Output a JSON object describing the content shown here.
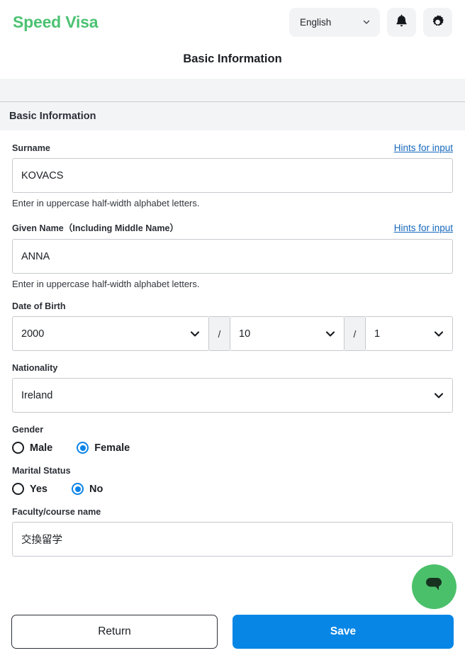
{
  "header": {
    "logo": "Speed Visa",
    "language": "English",
    "icons": {
      "language_chevron": "chevron-down-icon",
      "notifications": "bell-icon",
      "settings": "gear-icon"
    }
  },
  "page": {
    "title": "Basic Information",
    "section_title": "Basic Information"
  },
  "colors": {
    "brand_green": "#4BC272",
    "link_blue": "#1668BD",
    "accent_blue": "#0886E6",
    "chat_green": "#4BC06A",
    "section_gray": "#F3F4F6",
    "border_gray": "#C6C9CE"
  },
  "fields": {
    "surname": {
      "label": "Surname",
      "hint_link": "Hints for input",
      "value": "KOVACS",
      "placeholder": "",
      "helper": "Enter in uppercase half-width alphabet letters."
    },
    "given_name": {
      "label": "Given Name（Including Middle Name）",
      "hint_link": "Hints for input",
      "value": "ANNA",
      "placeholder": "",
      "helper": "Enter in uppercase half-width alphabet letters."
    },
    "date_of_birth": {
      "label": "Date of Birth",
      "year": "2000",
      "separator1": "/",
      "month": "10",
      "separator2": "/",
      "day": "1"
    },
    "nationality": {
      "label": "Nationality",
      "value": "Ireland"
    },
    "gender": {
      "label": "Gender",
      "options": [
        {
          "label": "Male",
          "selected": false
        },
        {
          "label": "Female",
          "selected": true
        }
      ]
    },
    "marital_status": {
      "label": "Marital Status",
      "options": [
        {
          "label": "Yes",
          "selected": false
        },
        {
          "label": "No",
          "selected": true
        }
      ]
    },
    "faculty": {
      "label": "Faculty/course name",
      "value": "交換留学",
      "placeholder": ""
    }
  },
  "actions": {
    "return_label": "Return",
    "save_label": "Save"
  },
  "chat": {
    "icon": "chat-bubble-icon"
  }
}
